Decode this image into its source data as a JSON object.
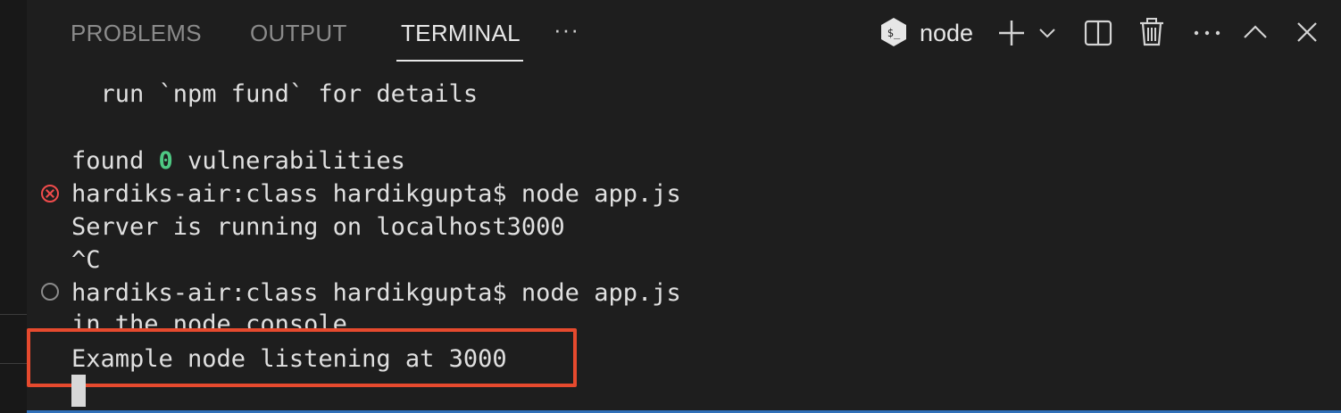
{
  "tabs": [
    {
      "label": "PROBLEMS",
      "active": false
    },
    {
      "label": "OUTPUT",
      "active": false
    },
    {
      "label": "TERMINAL",
      "active": true
    }
  ],
  "tabs_more": "···",
  "actions": {
    "shell_icon": "terminal-shell-icon",
    "shell_name": "node",
    "new_terminal_icon": "plus-icon",
    "dropdown_icon": "chevron-down-icon",
    "split_icon": "split-terminal-icon",
    "kill_icon": "trash-icon",
    "more_icon": "ellipsis-icon",
    "maximize_icon": "chevron-up-icon",
    "close_icon": "close-icon"
  },
  "terminal": {
    "lines": {
      "fund": "  run `npm fund` for details",
      "found_prefix": "found ",
      "found_count": "0",
      "found_suffix": " vulnerabilities",
      "cmd1": "hardiks-air:class hardikgupta$ node app.js",
      "server": "Server is running on localhost3000",
      "ctrlc": "^C",
      "cmd2": "hardiks-air:class hardikgupta$ node app.js",
      "console": "in the node console",
      "listening": "Example node listening at 3000"
    },
    "decorations": {
      "cmd1_status": "error",
      "cmd2_status": "running"
    }
  },
  "colors": {
    "background": "#1e1e1e",
    "success_number": "#4ec983",
    "error": "#f14c4c",
    "highlight_box": "#e64a2e",
    "accent": "#2f6fb8"
  }
}
